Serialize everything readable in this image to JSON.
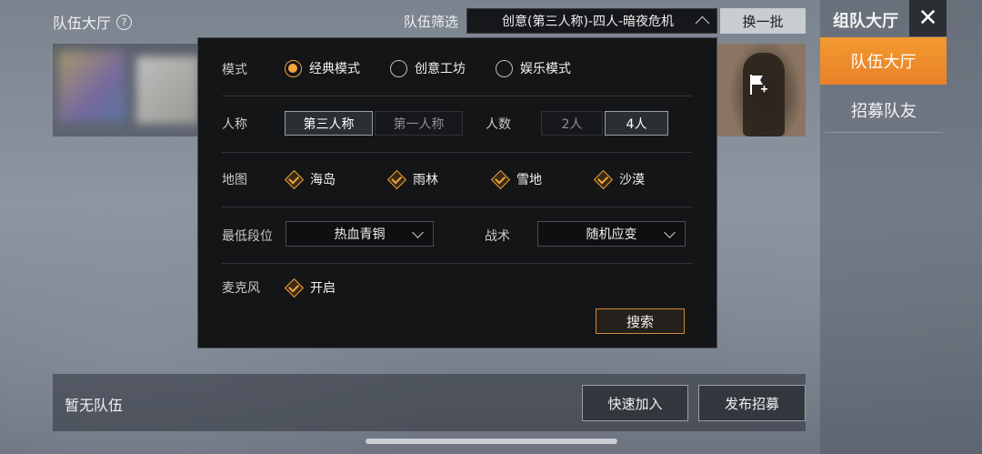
{
  "header": {
    "lobby_title": "队伍大厅",
    "filter_label": "队伍筛选",
    "filter_selected": "创意(第三人称)-四人-暗夜危机",
    "refresh_label": "换一批"
  },
  "side_panel": {
    "title": "组队大厅",
    "close_glyph": "✕",
    "tabs": [
      {
        "label": "队伍大厅",
        "active": true
      },
      {
        "label": "招募队友",
        "active": false
      }
    ]
  },
  "modal": {
    "mode": {
      "label": "模式",
      "options": [
        {
          "label": "经典模式",
          "selected": true
        },
        {
          "label": "创意工坊",
          "selected": false
        },
        {
          "label": "娱乐模式",
          "selected": false
        }
      ]
    },
    "perspective": {
      "label": "人称",
      "options": [
        {
          "label": "第三人称",
          "selected": true
        },
        {
          "label": "第一人称",
          "selected": false
        }
      ]
    },
    "team_size": {
      "label": "人数",
      "options": [
        {
          "label": "2人",
          "selected": false
        },
        {
          "label": "4人",
          "selected": true
        }
      ]
    },
    "map": {
      "label": "地图",
      "options": [
        {
          "label": "海岛",
          "checked": true
        },
        {
          "label": "雨林",
          "checked": true
        },
        {
          "label": "雪地",
          "checked": true
        },
        {
          "label": "沙漠",
          "checked": true
        }
      ]
    },
    "min_rank": {
      "label": "最低段位",
      "value": "热血青铜"
    },
    "tactic": {
      "label": "战术",
      "value": "随机应变"
    },
    "mic": {
      "label": "麦克风",
      "option": "开启",
      "checked": true
    },
    "search_label": "搜索"
  },
  "bottom": {
    "no_team_text": "暂无队伍",
    "quick_join_label": "快速加入",
    "publish_label": "发布招募"
  },
  "colors": {
    "accent": "#f3a33a",
    "active_tab": "#ea842b",
    "modal_bg": "#141517"
  }
}
